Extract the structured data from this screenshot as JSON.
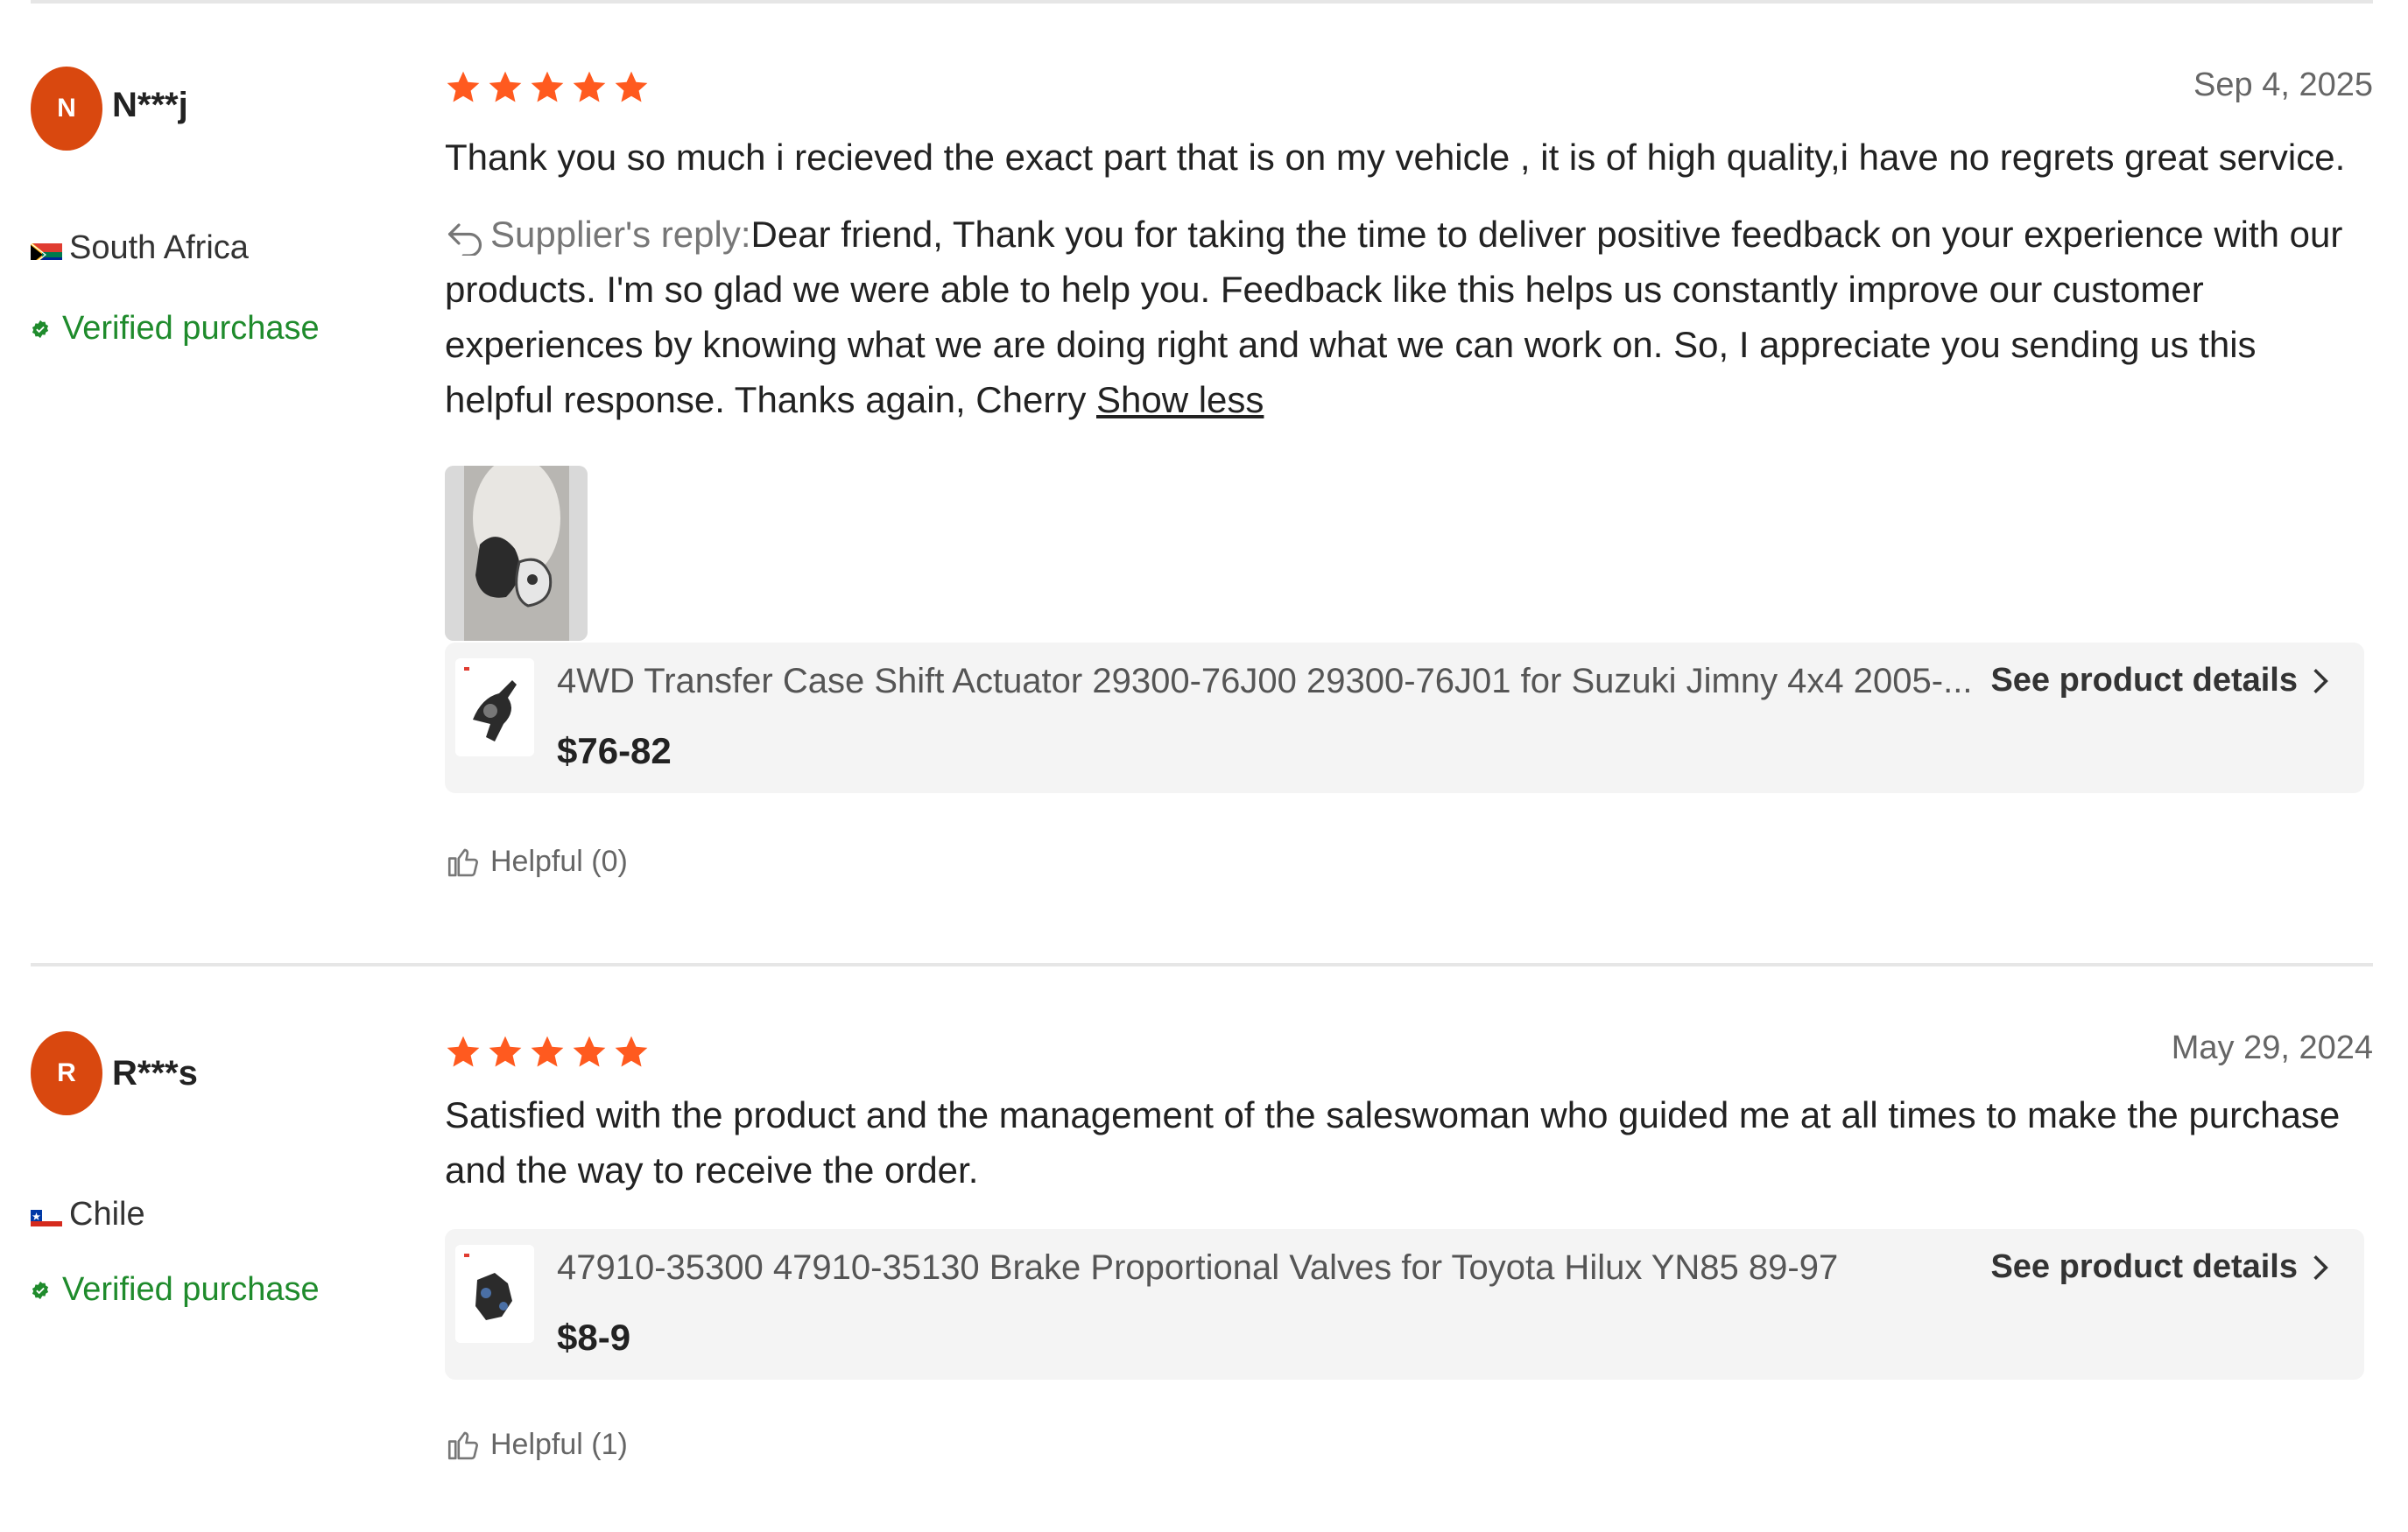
{
  "reviews": [
    {
      "avatar_letter": "N",
      "username": "N***j",
      "country": "South Africa",
      "flag_icon": "south-africa-flag",
      "verified_label": "Verified purchase",
      "rating": 5,
      "date": "Sep 4, 2025",
      "text": "Thank you so much i recieved the exact part that is on my vehicle , it is of high quality,i have no regrets great service.",
      "reply_label": "Supplier's reply:",
      "reply_text": "Dear friend, Thank you for taking the time to deliver positive feedback on your experience with our products. I'm so glad we were able to help you. Feedback like this helps us constantly improve our customer experiences by knowing what we are doing right and what we can work on. So, I appreciate you sending us this helpful response. Thanks again, Cherry",
      "show_less_label": "Show less",
      "product": {
        "title": "4WD Transfer Case Shift Actuator 29300-76J00 29300-76J01 for Suzuki Jimny 4x4 2005-...",
        "price": "$76-82",
        "details_label": "See product details"
      },
      "helpful_label": "Helpful (0)"
    },
    {
      "avatar_letter": "R",
      "username": "R***s",
      "country": "Chile",
      "flag_icon": "chile-flag",
      "verified_label": "Verified purchase",
      "rating": 5,
      "date": "May 29, 2024",
      "text": "Satisfied with the product and the management of the saleswoman who guided me at all times to make the purchase and the way to receive the order.",
      "product": {
        "title": "47910-35300 47910-35130 Brake Proportional Valves for Toyota Hilux YN85 89-97",
        "price": "$8-9",
        "details_label": "See product details"
      },
      "helpful_label": "Helpful (1)"
    }
  ],
  "colors": {
    "avatar": "#d9480f",
    "star": "#ff5a1f",
    "verified": "#1f8b2c",
    "card_bg": "#f4f4f4"
  }
}
